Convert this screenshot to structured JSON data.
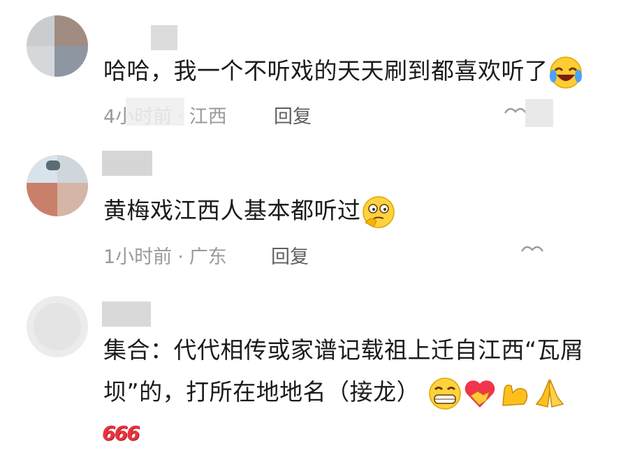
{
  "comments": [
    {
      "text": "哈哈，我一个不听戏的天天刷到都喜欢听了",
      "time": "4小时前",
      "location": "江西",
      "reply": "回复",
      "emojis": [
        "laughing-crying-emoji"
      ]
    },
    {
      "text": "黄梅戏江西人基本都听过",
      "time": "1小时前",
      "location": "广东",
      "reply": "回复",
      "emojis": [
        "thinking-emoji"
      ]
    },
    {
      "text_line1": "集合：代代相传或家谱记载祖上迁自江西“瓦屑",
      "text_line2": "坝”的，打所在地地名（接龙）",
      "badge": "666",
      "emojis": [
        "grinning-emoji",
        "handshake-heart-emoji",
        "flexed-arm-emoji",
        "praying-hands-emoji"
      ]
    }
  ],
  "colors": {
    "meta_text": "#9a9a9a",
    "reply_text": "#5f5f5f",
    "badge_red": "#e8343f"
  }
}
